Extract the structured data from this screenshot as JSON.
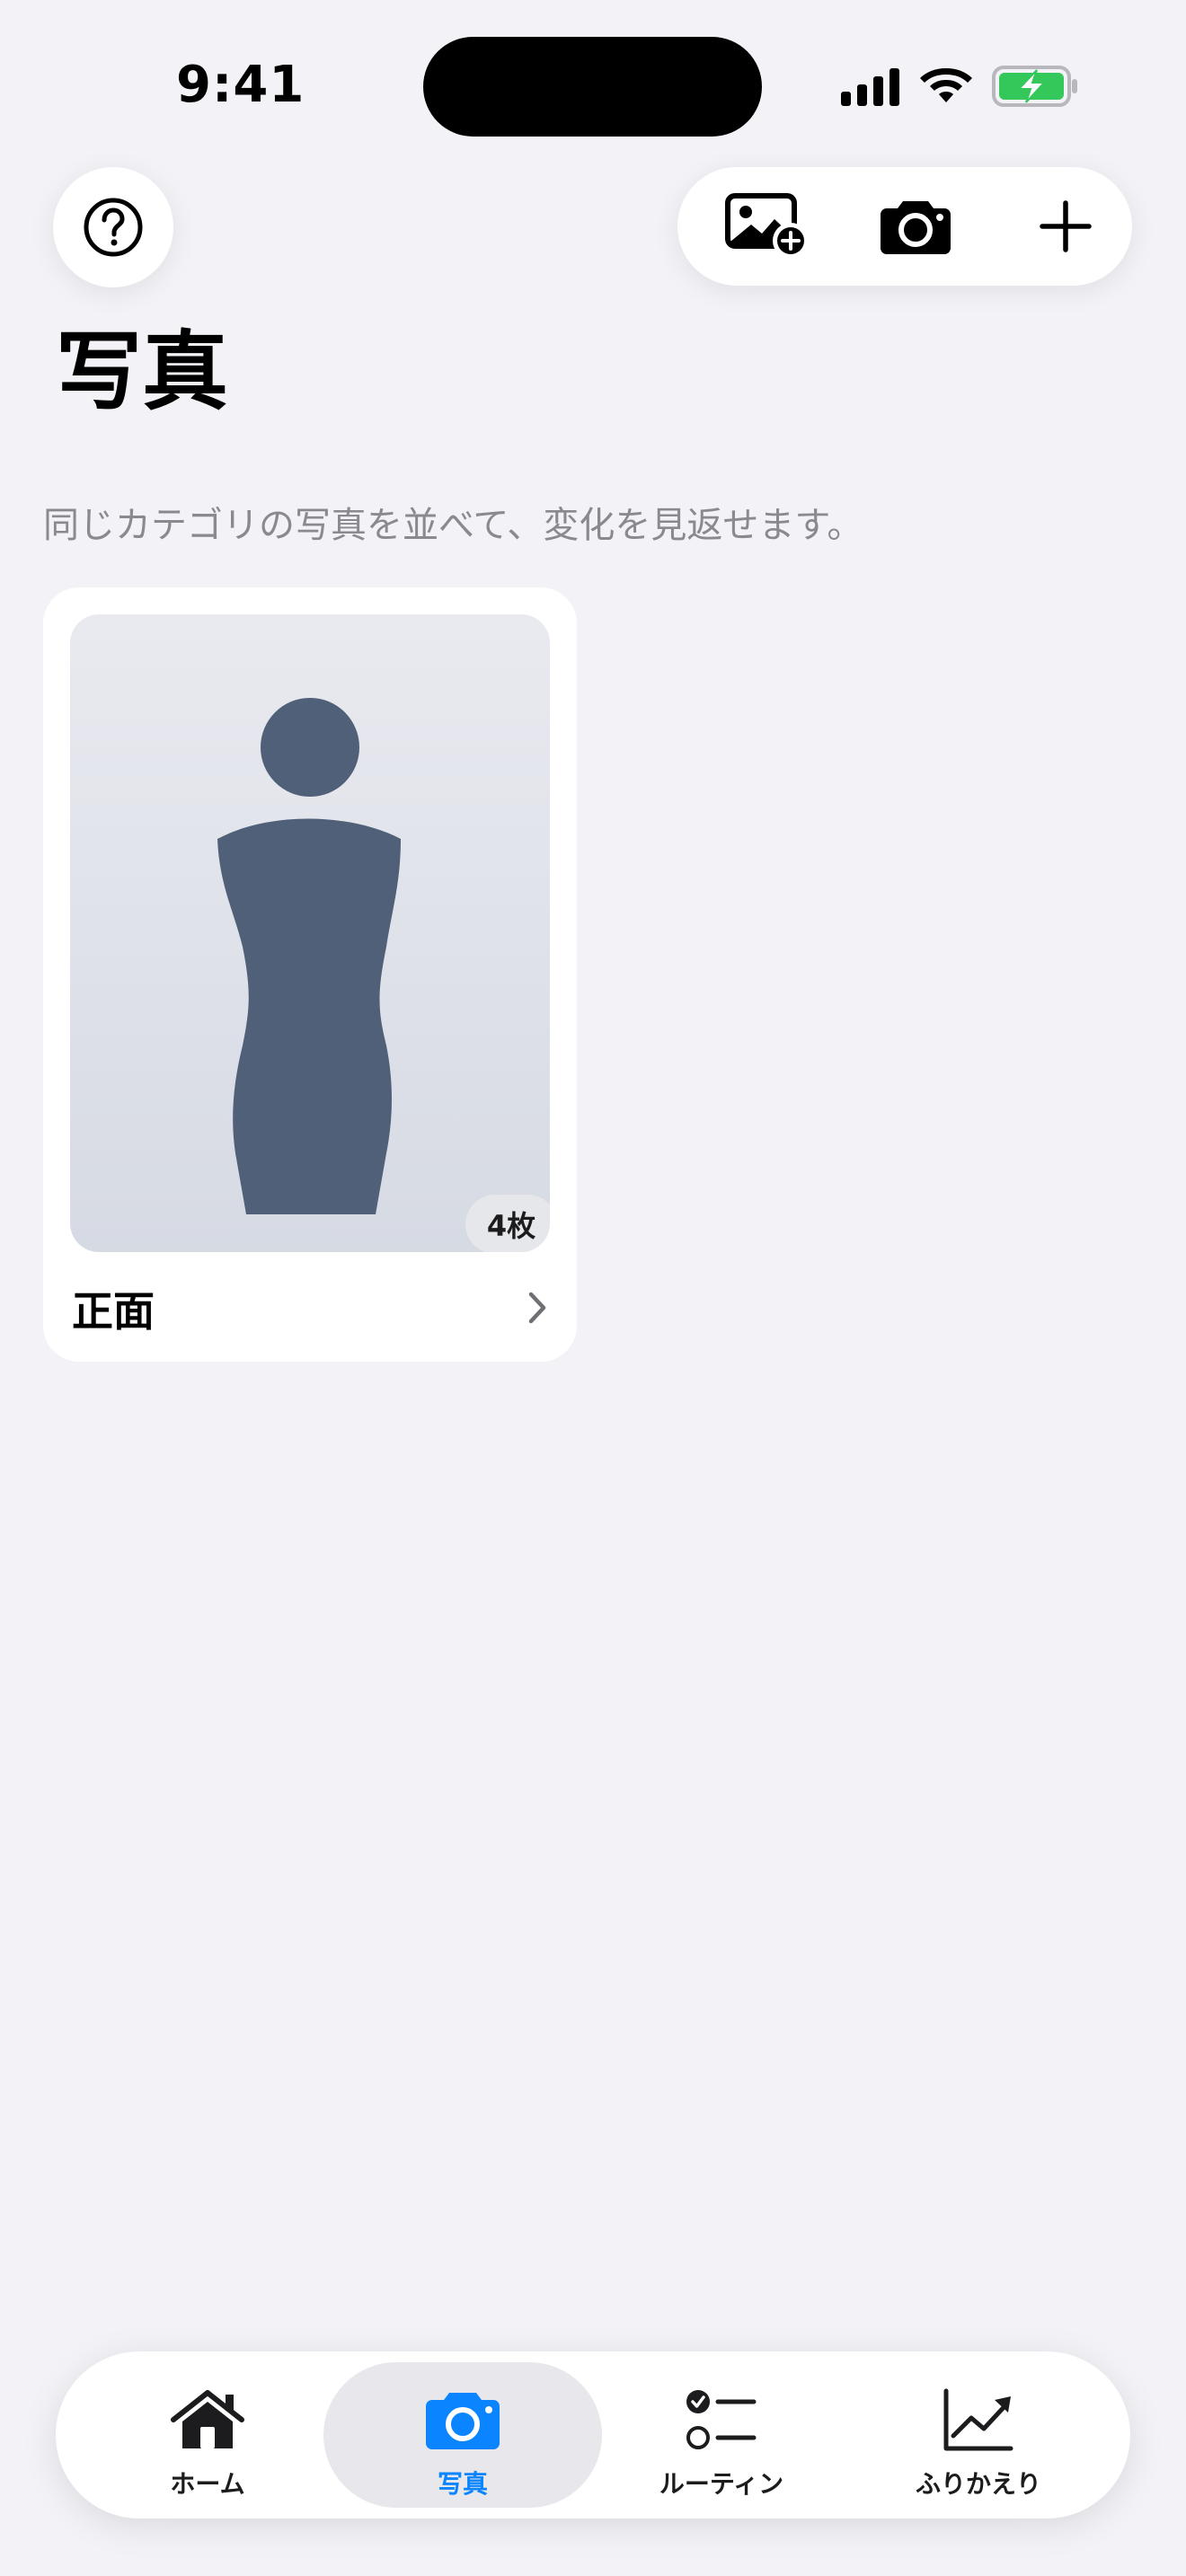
{
  "status_bar": {
    "time": "9:41"
  },
  "toolbar": {
    "help_icon": "question-circle-icon",
    "add_photo_icon": "photo-badge-plus-icon",
    "camera_icon": "camera-icon",
    "add_icon": "plus-icon"
  },
  "page": {
    "title": "写真",
    "subtitle": "同じカテゴリの写真を並べて、変化を見返せます。"
  },
  "categories": [
    {
      "name": "正面",
      "count_label": "4枚"
    }
  ],
  "tabbar": {
    "active_index": 1,
    "active_color": "#0A84FF",
    "items": [
      {
        "label": "ホーム",
        "icon": "house-icon"
      },
      {
        "label": "写真",
        "icon": "camera-fill-icon"
      },
      {
        "label": "ルーティン",
        "icon": "checklist-icon"
      },
      {
        "label": "ふりかえり",
        "icon": "chart-line-uptrend-icon"
      }
    ]
  },
  "colors": {
    "background": "#F2F2F7",
    "accent": "#0A84FF",
    "battery_charging": "#34C759",
    "silhouette": "#506078"
  }
}
